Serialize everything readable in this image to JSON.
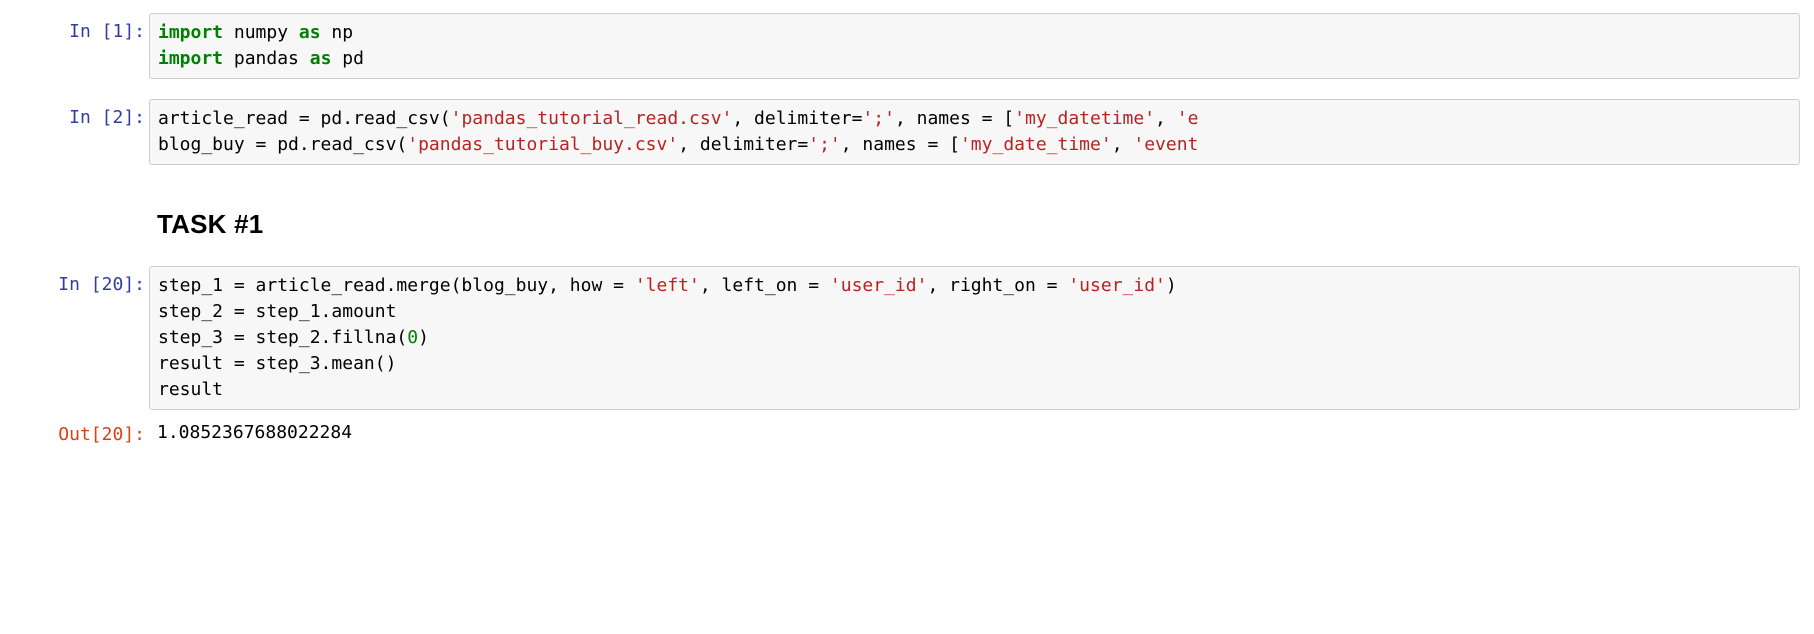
{
  "cell1": {
    "prompt_label": "In [1]:",
    "tokens": {
      "kw_import1": "import",
      "mod_numpy": " numpy ",
      "kw_as1": "as",
      "alias_np": " np",
      "nl1": "\n",
      "kw_import2": "import",
      "mod_pandas": " pandas ",
      "kw_as2": "as",
      "alias_pd": " pd"
    }
  },
  "cell2": {
    "prompt_label": "In [2]:",
    "tokens": {
      "l1a": "article_read = pd.read_csv(",
      "l1s1": "'pandas_tutorial_read.csv'",
      "l1b": ", delimiter=",
      "l1s2": "';'",
      "l1c": ", names = [",
      "l1s3": "'my_datetime'",
      "l1d": ", ",
      "l1s4": "'e",
      "nl": "\n",
      "l2a": "blog_buy = pd.read_csv(",
      "l2s1": "'pandas_tutorial_buy.csv'",
      "l2b": ", delimiter=",
      "l2s2": "';'",
      "l2c": ", names = [",
      "l2s3": "'my_date_time'",
      "l2d": ", ",
      "l2s4": "'event"
    }
  },
  "markdown1": {
    "heading": "TASK #1"
  },
  "cell3": {
    "prompt_label": "In [20]:",
    "tokens": {
      "l1a": "step_1 = article_read.merge(blog_buy, how = ",
      "l1s1": "'left'",
      "l1b": ", left_on = ",
      "l1s2": "'user_id'",
      "l1c": ", right_on = ",
      "l1s3": "'user_id'",
      "l1d": ")",
      "nl1": "\n",
      "l2": "step_2 = step_1.amount",
      "nl2": "\n",
      "l3a": "step_3 = step_2.fillna(",
      "l3n": "0",
      "l3b": ")",
      "nl3": "\n",
      "l4": "result = step_3.mean()",
      "nl4": "\n",
      "l5": "result"
    }
  },
  "out3": {
    "prompt_label": "Out[20]:",
    "value": "1.0852367688022284"
  }
}
